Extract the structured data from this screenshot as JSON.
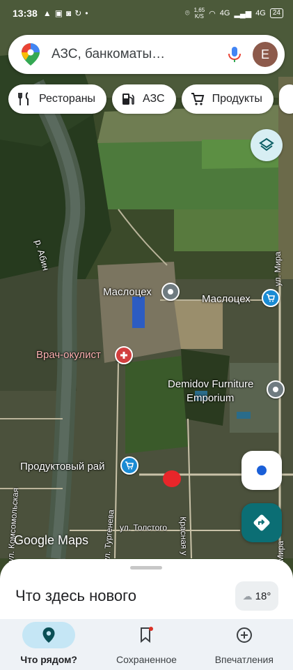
{
  "status_bar": {
    "time": "13:38",
    "net_speed_value": "1,65",
    "net_speed_unit": "K/S",
    "signal_1": "4G",
    "signal_2": "4G",
    "battery": "24"
  },
  "search": {
    "text": "АЗС, банкоматы…",
    "avatar_letter": "E"
  },
  "chips": [
    {
      "label": "Рестораны",
      "icon": "restaurant-icon"
    },
    {
      "label": "АЗС",
      "icon": "gas-station-icon"
    },
    {
      "label": "Продукты",
      "icon": "cart-icon"
    }
  ],
  "map": {
    "labels": {
      "river": "р. Абин",
      "maslotsekh_1": "Маслоцех",
      "maslotsekh_2": "Маслоцех",
      "doctor": "Врач-окулист",
      "furniture_1": "Demidov Furniture",
      "furniture_2": "Emporium",
      "grocery": "Продуктовый рай",
      "street_mira_top": "ул. Мира",
      "street_mira_bottom": "Мира",
      "street_tolstogo": "ул. Толстого",
      "street_turgeneva": "ул. Тургенева",
      "street_komsomolskaya": "ул. Комсомольская",
      "street_krasnaya": "Красная у",
      "google_maps": "Google Maps"
    }
  },
  "sheet": {
    "title": "Что здесь нового",
    "weather_temp": "18°"
  },
  "nav": {
    "items": [
      {
        "label": "Что рядом?",
        "icon": "location-pin-icon",
        "active": true
      },
      {
        "label": "Сохраненное",
        "icon": "bookmark-icon",
        "active": false
      },
      {
        "label": "Впечатления",
        "icon": "add-circle-icon",
        "active": false
      }
    ]
  },
  "colors": {
    "accent": "#1a5fd8",
    "directions": "#0b6e74",
    "nav_active": "#c5e6f5"
  }
}
